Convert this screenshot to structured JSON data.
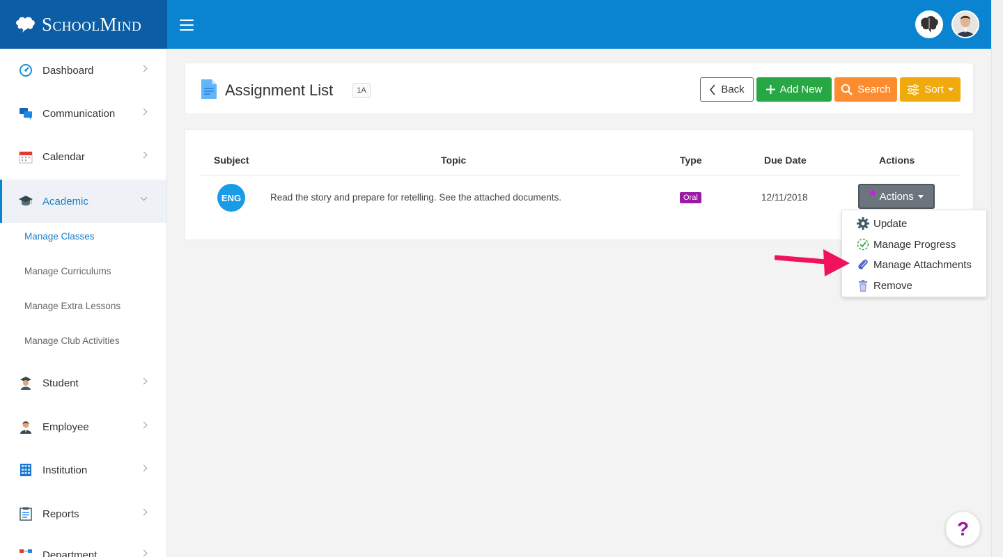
{
  "brand": {
    "name": "SchoolMind"
  },
  "colors": {
    "topbar": "#0a84d0",
    "brand_bg": "#0b5da6",
    "accent": "#1a7fc8",
    "add_button": "#28a745",
    "search_button": "#fd8c2f",
    "sort_button": "#f0aa0b",
    "type_badge": "#9c19a8",
    "subject_badge": "#1a9be8"
  },
  "sidebar": {
    "items": [
      {
        "label": "Dashboard",
        "icon": "dashboard-gauge-icon"
      },
      {
        "label": "Communication",
        "icon": "chat-bubbles-icon"
      },
      {
        "label": "Calendar",
        "icon": "calendar-icon"
      },
      {
        "label": "Academic",
        "icon": "graduation-cap-icon",
        "expanded": true
      },
      {
        "label": "Student",
        "icon": "student-icon"
      },
      {
        "label": "Employee",
        "icon": "employee-icon"
      },
      {
        "label": "Institution",
        "icon": "building-icon"
      },
      {
        "label": "Reports",
        "icon": "clipboard-icon"
      },
      {
        "label": "Department",
        "icon": "department-icon"
      }
    ],
    "academic_sub": [
      {
        "label": "Manage Classes",
        "current": true
      },
      {
        "label": "Manage Curriculums"
      },
      {
        "label": "Manage Extra Lessons"
      },
      {
        "label": "Manage Club Activities"
      }
    ]
  },
  "header": {
    "title": "Assignment List",
    "class_badge": "1A",
    "back_label": "Back",
    "add_label": "Add New",
    "search_label": "Search",
    "sort_label": "Sort"
  },
  "table": {
    "columns": [
      "Subject",
      "Topic",
      "Type",
      "Due Date",
      "Actions"
    ],
    "rows": [
      {
        "subject": "ENG",
        "topic": "Read the story and prepare for retelling. See the attached documents.",
        "type": "Oral",
        "due_date": "12/11/2018",
        "actions_label": "Actions"
      }
    ]
  },
  "actions_menu": {
    "items": [
      {
        "label": "Update",
        "icon": "gear-icon"
      },
      {
        "label": "Manage Progress",
        "icon": "progress-check-icon"
      },
      {
        "label": "Manage Attachments",
        "icon": "paperclip-icon"
      },
      {
        "label": "Remove",
        "icon": "trash-icon"
      }
    ]
  },
  "help": {
    "label": "?"
  }
}
